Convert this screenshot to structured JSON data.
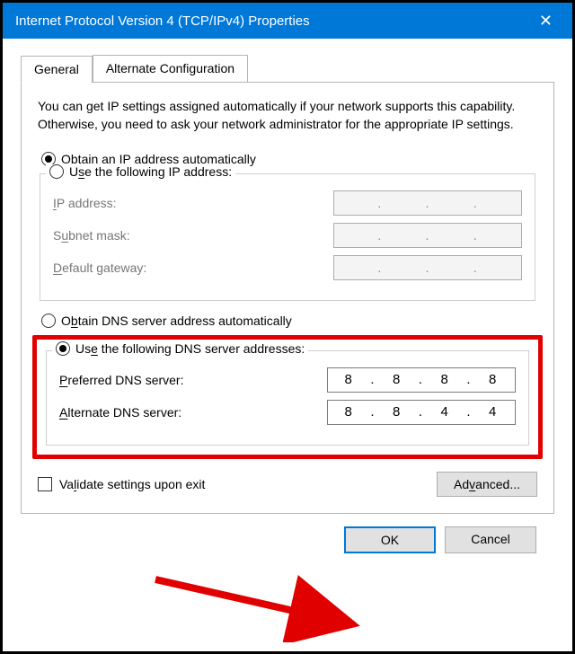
{
  "window": {
    "title": "Internet Protocol Version 4 (TCP/IPv4) Properties",
    "close": "✕"
  },
  "tabs": {
    "general": "General",
    "alternate": "Alternate Configuration"
  },
  "intro": "You can get IP settings assigned automatically if your network supports this capability. Otherwise, you need to ask your network administrator for the appropriate IP settings.",
  "ip": {
    "auto": "Obtain an IP address automatically",
    "manual": "Use the following IP address:",
    "address_label": "IP address:",
    "subnet_label": "Subnet mask:",
    "gateway_label": "Default gateway:"
  },
  "dns": {
    "auto": "Obtain DNS server address automatically",
    "manual": "Use the following DNS server addresses:",
    "preferred_label": "Preferred DNS server:",
    "alternate_label": "Alternate DNS server:",
    "preferred_value": [
      "8",
      "8",
      "8",
      "8"
    ],
    "alternate_value": [
      "8",
      "8",
      "4",
      "4"
    ]
  },
  "validate": "Validate settings upon exit",
  "buttons": {
    "advanced": "Advanced...",
    "ok": "OK",
    "cancel": "Cancel"
  }
}
